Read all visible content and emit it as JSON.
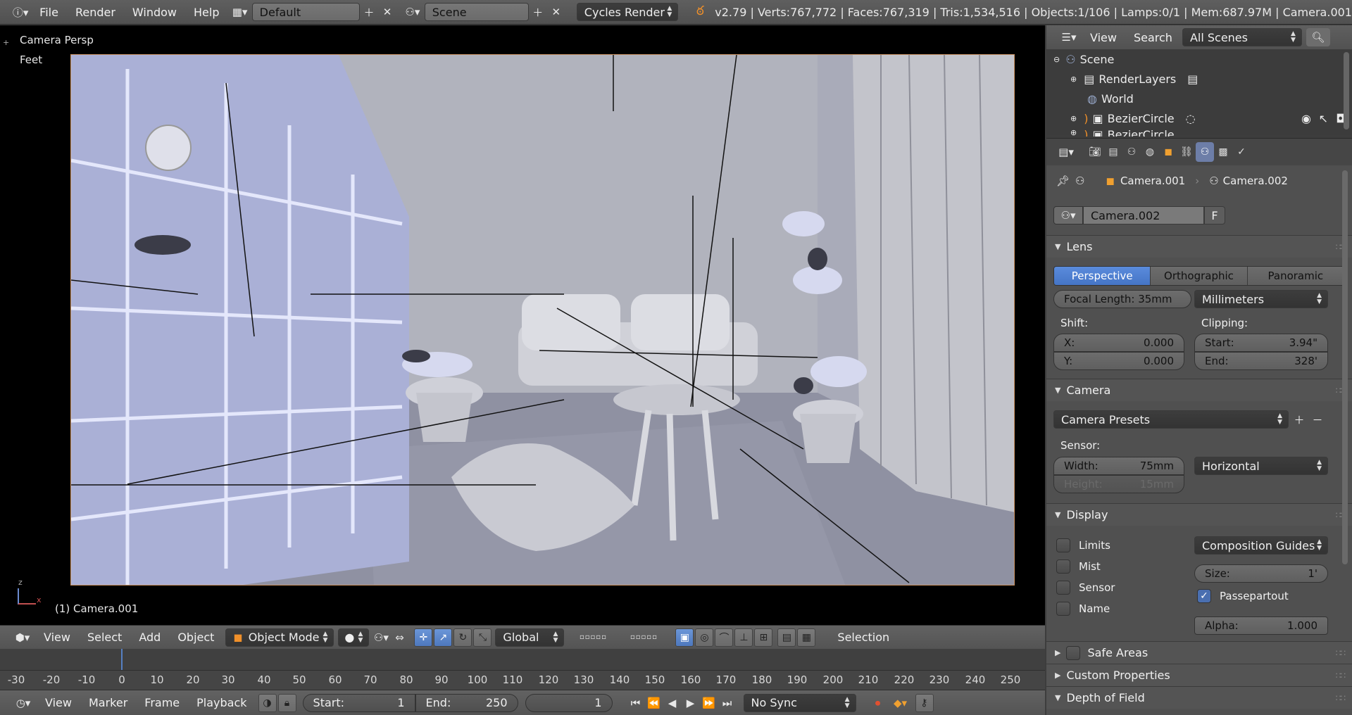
{
  "topbar": {
    "menus": [
      "File",
      "Render",
      "Window",
      "Help"
    ],
    "screen_layout": "Default",
    "scene": "Scene",
    "engine": "Cycles Render",
    "stats": "v2.79 | Verts:767,772 | Faces:767,319 | Tris:1,534,516 | Objects:1/106 | Lamps:0/1 | Mem:687.97M | Camera.001"
  },
  "viewport": {
    "view_name": "Camera Persp",
    "units": "Feet",
    "active_object": "(1) Camera.001",
    "axis_z": "z",
    "axis_x": "x"
  },
  "view3d_header": {
    "menus": [
      "View",
      "Select",
      "Add",
      "Object"
    ],
    "mode": "Object Mode",
    "orientation": "Global",
    "selection_label": "Selection"
  },
  "timeline": {
    "ticks": [
      "-30",
      "-20",
      "-10",
      "0",
      "10",
      "20",
      "30",
      "40",
      "50",
      "60",
      "70",
      "80",
      "90",
      "100",
      "110",
      "120",
      "130",
      "140",
      "150",
      "160",
      "170",
      "180",
      "190",
      "200",
      "210",
      "220",
      "230",
      "240",
      "250"
    ],
    "menus": [
      "View",
      "Marker",
      "Frame",
      "Playback"
    ],
    "start_label": "Start:",
    "start_value": "1",
    "end_label": "End:",
    "end_value": "250",
    "current_frame": "1",
    "sync": "No Sync"
  },
  "outliner": {
    "menus": [
      "View",
      "Search"
    ],
    "display_mode": "All Scenes",
    "rows": [
      {
        "label": "Scene"
      },
      {
        "label": "RenderLayers"
      },
      {
        "label": "World"
      },
      {
        "label": "BezierCircle"
      },
      {
        "label": "BezierCircle"
      }
    ]
  },
  "properties": {
    "breadcrumb_object": "Camera.001",
    "breadcrumb_data": "Camera.002",
    "datablock_name": "Camera.002",
    "fake_user": "F",
    "lens": {
      "title": "Lens",
      "types": [
        "Perspective",
        "Orthographic",
        "Panoramic"
      ],
      "active_type": "Perspective",
      "focal_length": "Focal Length: 35mm",
      "lens_unit": "Millimeters",
      "shift_label": "Shift:",
      "shift_x_label": "X:",
      "shift_x": "0.000",
      "shift_y_label": "Y:",
      "shift_y": "0.000",
      "clipping_label": "Clipping:",
      "clip_start_label": "Start:",
      "clip_start": "3.94\"",
      "clip_end_label": "End:",
      "clip_end": "328'"
    },
    "camera": {
      "title": "Camera",
      "presets": "Camera Presets",
      "sensor_label": "Sensor:",
      "width_label": "Width:",
      "width": "75mm",
      "height_label": "Height:",
      "height": "15mm",
      "fit": "Horizontal"
    },
    "display": {
      "title": "Display",
      "limits": "Limits",
      "mist": "Mist",
      "sensor": "Sensor",
      "name": "Name",
      "guides": "Composition Guides",
      "size_label": "Size:",
      "size": "1'",
      "passepartout": "Passepartout",
      "alpha_label": "Alpha:",
      "alpha": "1.000"
    },
    "collapsed": [
      "Safe Areas",
      "Custom Properties",
      "Depth of Field"
    ]
  }
}
